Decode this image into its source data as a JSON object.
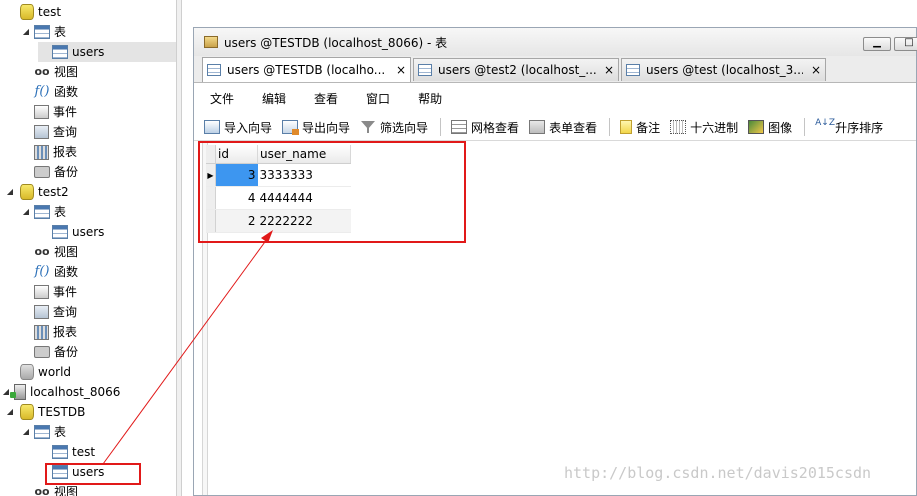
{
  "tree": {
    "nodes": [
      {
        "label": "test",
        "icon": "database-icon",
        "arrow": ""
      },
      {
        "label": "表",
        "icon": "table-folder-icon",
        "arrow": "◢"
      },
      {
        "label": "users",
        "icon": "table-icon",
        "arrow": ""
      },
      {
        "label": "视图",
        "icon": "view-icon",
        "arrow": ""
      },
      {
        "label": "函数",
        "icon": "function-icon",
        "arrow": ""
      },
      {
        "label": "事件",
        "icon": "event-icon",
        "arrow": ""
      },
      {
        "label": "查询",
        "icon": "query-icon",
        "arrow": ""
      },
      {
        "label": "报表",
        "icon": "report-icon",
        "arrow": ""
      },
      {
        "label": "备份",
        "icon": "backup-icon",
        "arrow": ""
      },
      {
        "label": "test2",
        "icon": "database-icon",
        "arrow": "◢"
      },
      {
        "label": "表",
        "icon": "table-folder-icon",
        "arrow": "◢"
      },
      {
        "label": "users",
        "icon": "table-icon",
        "arrow": ""
      },
      {
        "label": "视图",
        "icon": "view-icon",
        "arrow": ""
      },
      {
        "label": "函数",
        "icon": "function-icon",
        "arrow": ""
      },
      {
        "label": "事件",
        "icon": "event-icon",
        "arrow": ""
      },
      {
        "label": "查询",
        "icon": "query-icon",
        "arrow": ""
      },
      {
        "label": "报表",
        "icon": "report-icon",
        "arrow": ""
      },
      {
        "label": "备份",
        "icon": "backup-icon",
        "arrow": ""
      },
      {
        "label": "world",
        "icon": "database-grey-icon",
        "arrow": ""
      },
      {
        "label": "localhost_8066",
        "icon": "server-icon",
        "arrow": "◢"
      },
      {
        "label": "TESTDB",
        "icon": "database-icon",
        "arrow": "◢"
      },
      {
        "label": "表",
        "icon": "table-folder-icon",
        "arrow": "◢"
      },
      {
        "label": "test",
        "icon": "table-icon",
        "arrow": ""
      },
      {
        "label": "users",
        "icon": "table-icon",
        "arrow": ""
      },
      {
        "label": "视图",
        "icon": "view-icon",
        "arrow": ""
      }
    ]
  },
  "window": {
    "title": "users @TESTDB (localhost_8066) - 表",
    "min_glyph": "▁",
    "max_glyph": "□"
  },
  "tabs": [
    {
      "label": "users @TESTDB (localho...",
      "close": "×"
    },
    {
      "label": "users @test2 (localhost_...",
      "close": "×"
    },
    {
      "label": "users @test (localhost_3...",
      "close": "×"
    }
  ],
  "menu": [
    "文件",
    "编辑",
    "查看",
    "窗口",
    "帮助"
  ],
  "toolbar": {
    "import": "导入向导",
    "export": "导出向导",
    "filter": "筛选向导",
    "grid_view": "网格查看",
    "form_view": "表单查看",
    "memo": "备注",
    "hex": "十六进制",
    "image": "图像",
    "sort_asc": "升序排序",
    "sort_glyph": "A↓Z"
  },
  "grid": {
    "columns": [
      "id",
      "user_name"
    ],
    "current_row_marker": "▶",
    "rows": [
      {
        "id": "3",
        "user_name": "3333333"
      },
      {
        "id": "4",
        "user_name": "4444444"
      },
      {
        "id": "2",
        "user_name": "2222222"
      }
    ]
  },
  "annotation": {
    "color": "#e11919"
  },
  "watermark": "http://blog.csdn.net/davis2015csdn"
}
